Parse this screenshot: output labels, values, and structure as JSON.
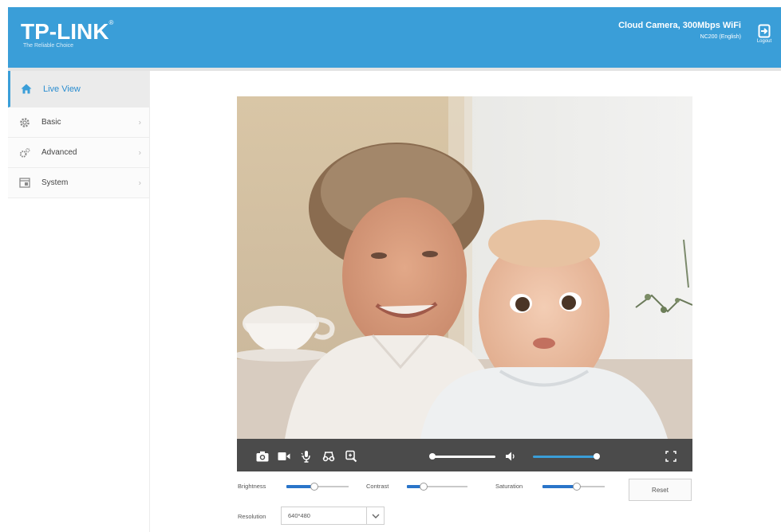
{
  "header": {
    "logo_text": "TP-LINK",
    "logo_mark": "®",
    "tagline": "The Reliable Choice",
    "product_name": "Cloud Camera, 300Mbps WiFi",
    "model": "NC200  (English)",
    "logout_label": "Logout",
    "brand_color": "#3a9ed8"
  },
  "sidebar": {
    "items": [
      {
        "label": "Live View",
        "icon": "home-icon",
        "active": true
      },
      {
        "label": "Basic",
        "icon": "gear-icon",
        "active": false
      },
      {
        "label": "Advanced",
        "icon": "gears-icon",
        "active": false
      },
      {
        "label": "System",
        "icon": "system-icon",
        "active": false
      }
    ]
  },
  "player": {
    "controls": [
      "camera-snapshot-icon",
      "record-video-icon",
      "talk-microphone-icon",
      "night-vision-icon",
      "zoom-icon",
      "volume-icon",
      "fullscreen-icon"
    ]
  },
  "adjustments": {
    "brightness_label": "Brightness",
    "brightness_value": 0.45,
    "contrast_label": "Contrast",
    "contrast_value": 0.25,
    "saturation_label": "Saturation",
    "saturation_value": 0.55,
    "reset_label": "Reset"
  },
  "resolution": {
    "label": "Resolution",
    "value": "640*480"
  }
}
